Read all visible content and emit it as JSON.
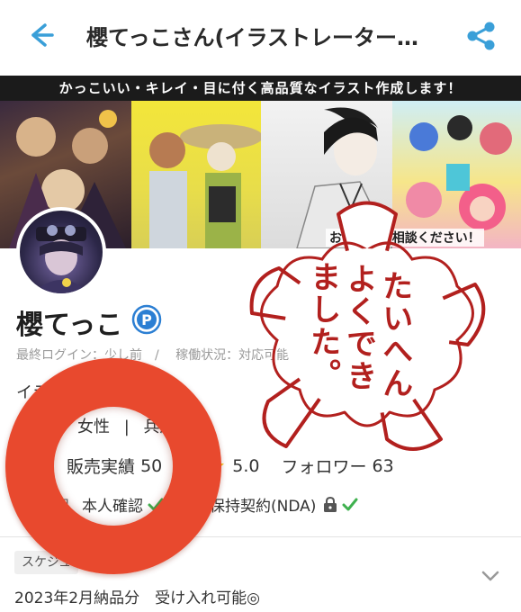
{
  "header": {
    "title": "櫻てっこさん(イラストレーター…",
    "back_icon": "back-arrow-icon",
    "share_icon": "share-icon",
    "accent_color": "#3a9fd8"
  },
  "banner": {
    "catchphrase": "かっこいい・キレイ・目に付く高品質なイラスト作成します！",
    "note": "お気軽にご相談ください！"
  },
  "profile": {
    "name": "櫻てっこ",
    "pro_badge": "P",
    "last_login": "最終ログイン：少し前",
    "work_status": "稼働状況：対応可能",
    "profession": "イラ",
    "attributes": [
      "女性",
      "兵庫"
    ],
    "sales_label": "販売実績",
    "sales_value": "50",
    "rating": "5.0",
    "followers_label": "フォロワー",
    "followers_value": "63",
    "verification_label": "況",
    "identity_label": "本人確認",
    "nda_label": "機密保持契約(NDA)",
    "check_color": "#3fb14f"
  },
  "schedule": {
    "tag": "スケジュ",
    "text": "2023年2月納品分　受け入れ可能◎"
  },
  "overlay": {
    "stamp_lines": [
      "たいへん",
      "よくでき",
      "ました。"
    ],
    "stamp_color": "#b2201e",
    "ring_color": "#e8492e"
  }
}
